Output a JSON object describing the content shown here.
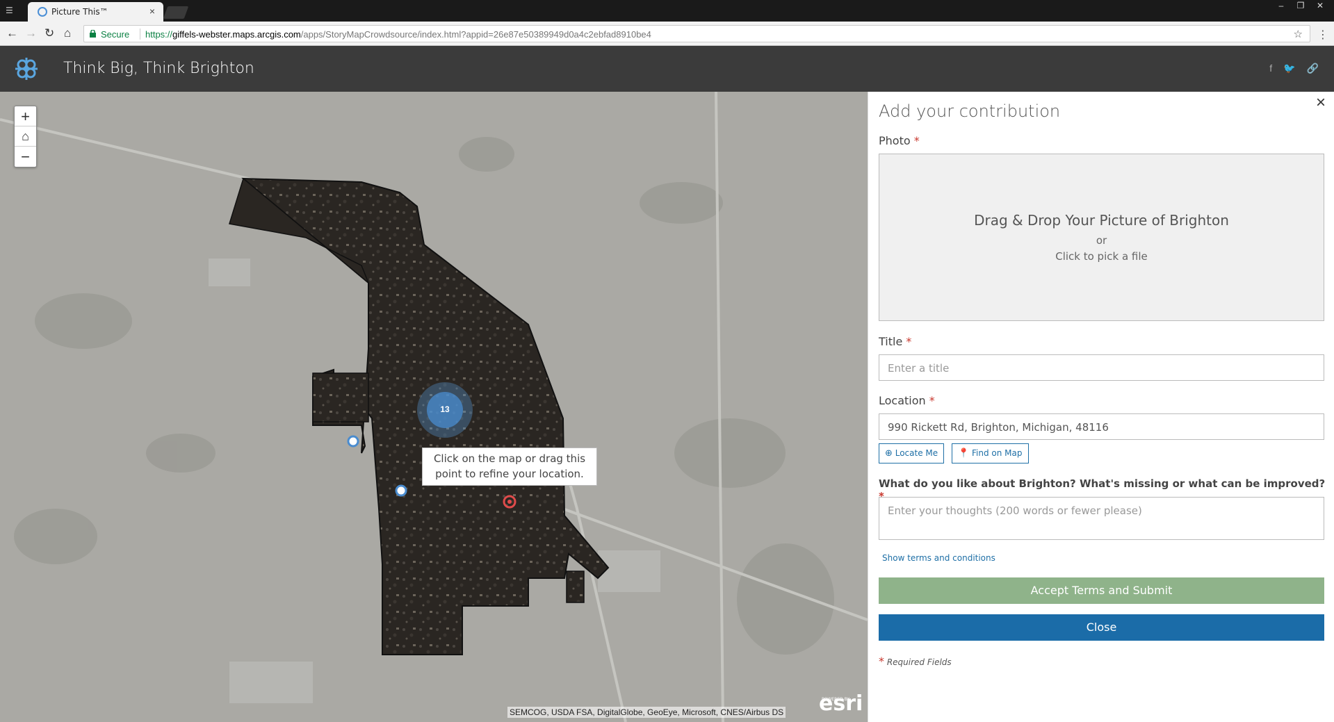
{
  "browser": {
    "tab_title": "Picture This™",
    "secure_label": "Secure",
    "url_scheme": "https://",
    "url_host": "giffels-webster.maps.arcgis.com",
    "url_path": "/apps/StoryMapCrowdsource/index.html?appid=26e87e50389949d0a4c2ebfad8910be4"
  },
  "app": {
    "title": "Think Big, Think Brighton"
  },
  "map": {
    "cluster_count": "13",
    "tooltip_line1": "Click on the map or drag this",
    "tooltip_line2": "point to refine your location.",
    "attribution": "SEMCOG, USDA FSA, DigitalGlobe, GeoEye, Microsoft, CNES/Airbus DS",
    "esri_powered": "POWERED BY",
    "esri_label": "esri"
  },
  "panel": {
    "title": "Add your contribution",
    "photo_label": "Photo",
    "drop_main": "Drag & Drop Your Picture of Brighton",
    "drop_or": "or",
    "drop_pick": "Click to pick a file",
    "title_label": "Title",
    "title_placeholder": "Enter a title",
    "location_label": "Location",
    "location_value": "990 Rickett Rd, Brighton, Michigan, 48116",
    "locate_me": "Locate Me",
    "find_on_map": "Find on Map",
    "question_label": "What do you like about Brighton? What's missing or what can be improved?",
    "question_placeholder": "Enter your thoughts (200 words or fewer please)",
    "terms_link": "Show terms and conditions",
    "submit_label": "Accept Terms and Submit",
    "close_label": "Close",
    "required_note": "Required Fields",
    "required_mark": "*"
  },
  "colors": {
    "header_bg": "#3b3b3b",
    "submit_bg": "#8fb38a",
    "close_bg": "#1b6ca8",
    "required": "#c8372d",
    "link": "#1e6fa6"
  }
}
